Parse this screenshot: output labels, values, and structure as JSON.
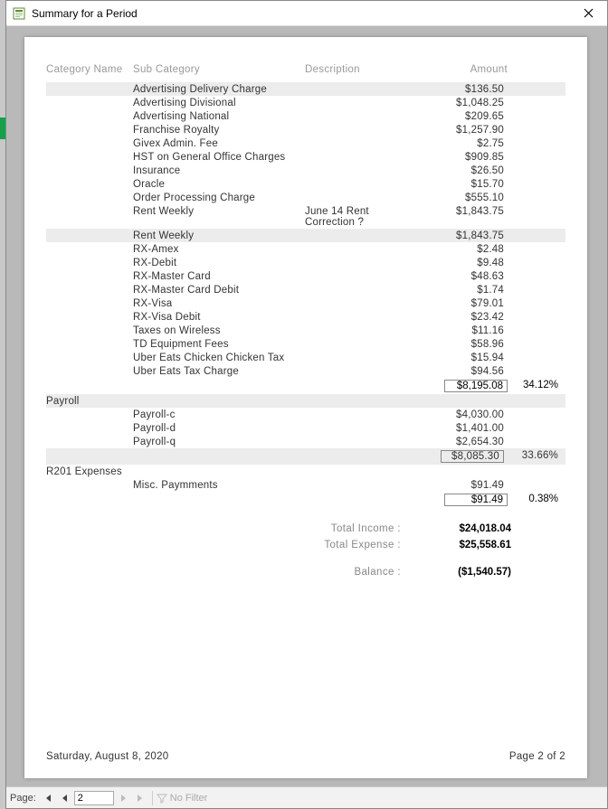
{
  "window": {
    "title": "Summary for a Period"
  },
  "report": {
    "headers": {
      "category": "Category Name",
      "sub": "Sub Category",
      "desc": "Description",
      "amount": "Amount"
    },
    "sections": [
      {
        "category": "",
        "rows": [
          {
            "sub": "Advertising Delivery Charge",
            "desc": "",
            "amount": "$136.50",
            "shade": true
          },
          {
            "sub": "Advertising Divisional",
            "desc": "",
            "amount": "$1,048.25"
          },
          {
            "sub": "Advertising National",
            "desc": "",
            "amount": "$209.65"
          },
          {
            "sub": "Franchise Royalty",
            "desc": "",
            "amount": "$1,257.90"
          },
          {
            "sub": "Givex Admin. Fee",
            "desc": "",
            "amount": "$2.75"
          },
          {
            "sub": "HST on General Office Charges",
            "desc": "",
            "amount": "$909.85"
          },
          {
            "sub": "Insurance",
            "desc": "",
            "amount": "$26.50"
          },
          {
            "sub": "Oracle",
            "desc": "",
            "amount": "$15.70"
          },
          {
            "sub": "Order Processing Charge",
            "desc": "",
            "amount": "$555.10"
          },
          {
            "sub": "Rent Weekly",
            "desc": "June 14 Rent Correction ?",
            "amount": "$1,843.75"
          },
          {
            "sub": "Rent Weekly",
            "desc": "",
            "amount": "$1,843.75",
            "shade": true
          },
          {
            "sub": "RX-Amex",
            "desc": "",
            "amount": "$2.48"
          },
          {
            "sub": "RX-Debit",
            "desc": "",
            "amount": "$9.48"
          },
          {
            "sub": "RX-Master Card",
            "desc": "",
            "amount": "$48.63"
          },
          {
            "sub": "RX-Master Card Debit",
            "desc": "",
            "amount": "$1.74"
          },
          {
            "sub": "RX-Visa",
            "desc": "",
            "amount": "$79.01"
          },
          {
            "sub": "RX-Visa Debit",
            "desc": "",
            "amount": "$23.42"
          },
          {
            "sub": "Taxes on Wireless",
            "desc": "",
            "amount": "$11.16"
          },
          {
            "sub": "TD Equipment Fees",
            "desc": "",
            "amount": "$58.96"
          },
          {
            "sub": "Uber Eats Chicken Chicken Tax",
            "desc": "",
            "amount": "$15.94"
          },
          {
            "sub": "Uber Eats Tax Charge",
            "desc": "",
            "amount": "$94.56"
          }
        ],
        "subtotal": {
          "amount": "$8,195.08",
          "pct": "34.12%"
        }
      },
      {
        "category": "Payroll",
        "rows": [
          {
            "sub": "Payroll-c",
            "desc": "",
            "amount": "$4,030.00"
          },
          {
            "sub": "Payroll-d",
            "desc": "",
            "amount": "$1,401.00"
          },
          {
            "sub": "Payroll-q",
            "desc": "",
            "amount": "$2,654.30"
          }
        ],
        "subtotal": {
          "amount": "$8,085.30",
          "pct": "33.66%"
        }
      },
      {
        "category": "R201 Expenses",
        "rows": [
          {
            "sub": "Misc. Paymments",
            "desc": "",
            "amount": "$91.49"
          }
        ],
        "subtotal": {
          "amount": "$91.49",
          "pct": "0.38%"
        }
      }
    ],
    "totals": {
      "income_label": "Total Income :",
      "income": "$24,018.04",
      "expense_label": "Total Expense :",
      "expense": "$25,558.61",
      "balance_label": "Balance :",
      "balance": "($1,540.57)"
    },
    "footer": {
      "date": "Saturday, August 8, 2020",
      "page": "Page 2 of 2"
    }
  },
  "nav": {
    "label": "Page:",
    "value": "2",
    "nofilter": "No Filter"
  }
}
